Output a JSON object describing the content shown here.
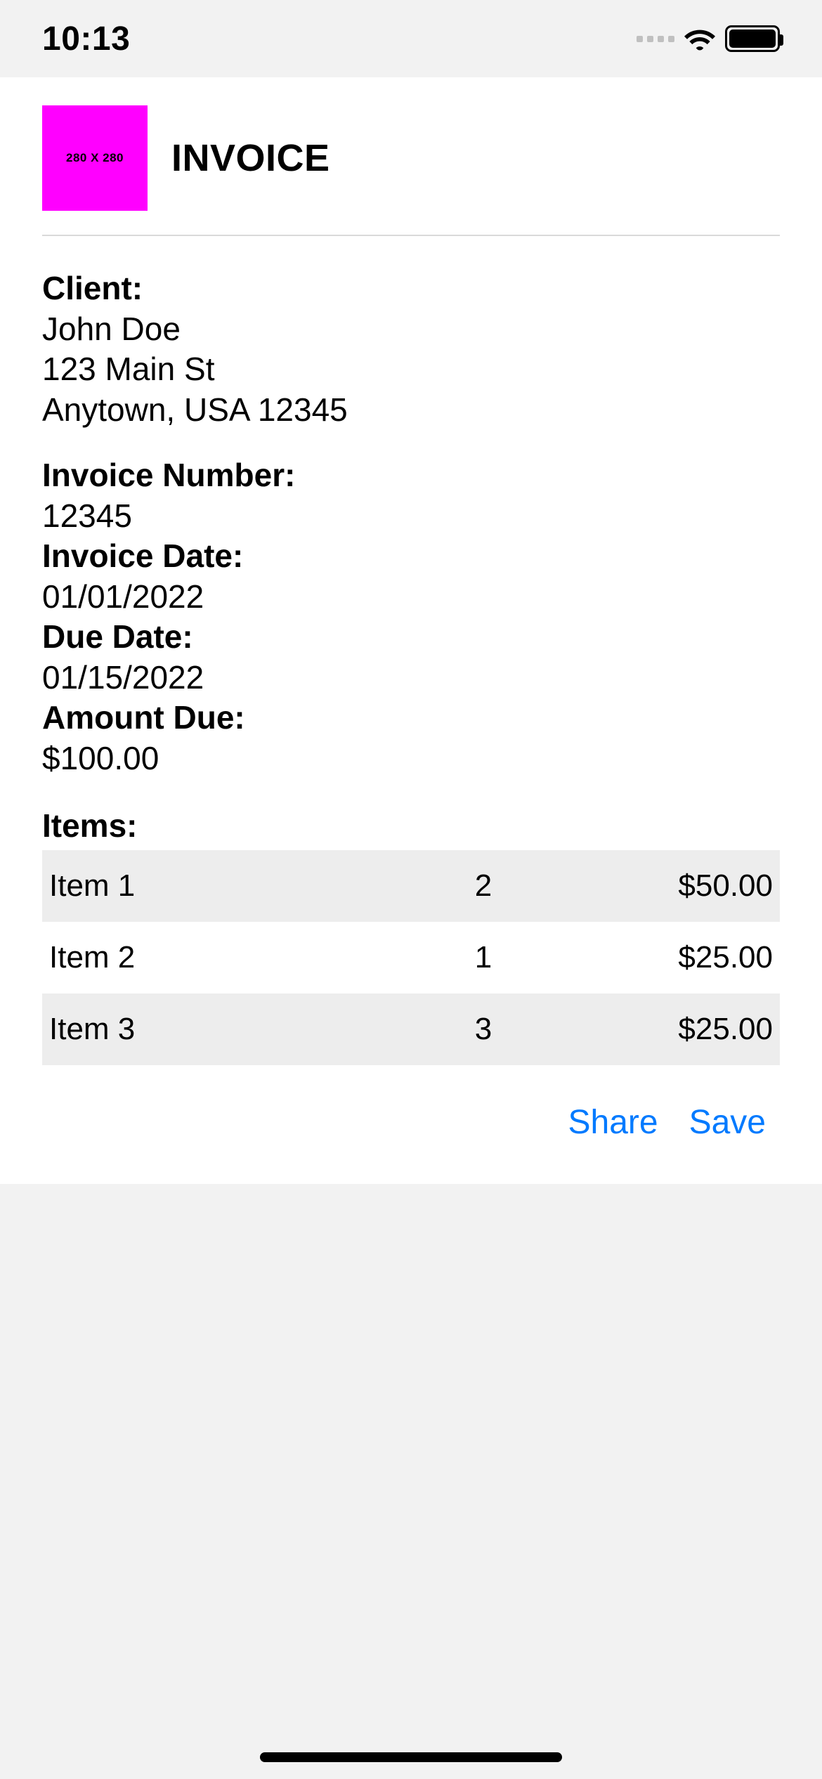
{
  "status": {
    "time": "10:13"
  },
  "logo": {
    "placeholder_text": "280 X 280"
  },
  "title": "INVOICE",
  "client": {
    "label": "Client:",
    "name": "John Doe",
    "street": "123 Main St",
    "city_line": "Anytown, USA 12345"
  },
  "meta": {
    "invoice_number": {
      "label": "Invoice Number:",
      "value": "12345"
    },
    "invoice_date": {
      "label": "Invoice Date:",
      "value": "01/01/2022"
    },
    "due_date": {
      "label": "Due Date:",
      "value": "01/15/2022"
    },
    "amount_due": {
      "label": "Amount Due:",
      "value": "$100.00"
    }
  },
  "items": {
    "heading": "Items:",
    "rows": [
      {
        "name": "Item 1",
        "qty": "2",
        "price": "$50.00"
      },
      {
        "name": "Item 2",
        "qty": "1",
        "price": "$25.00"
      },
      {
        "name": "Item 3",
        "qty": "3",
        "price": "$25.00"
      }
    ]
  },
  "actions": {
    "share_label": "Share",
    "save_label": "Save"
  }
}
